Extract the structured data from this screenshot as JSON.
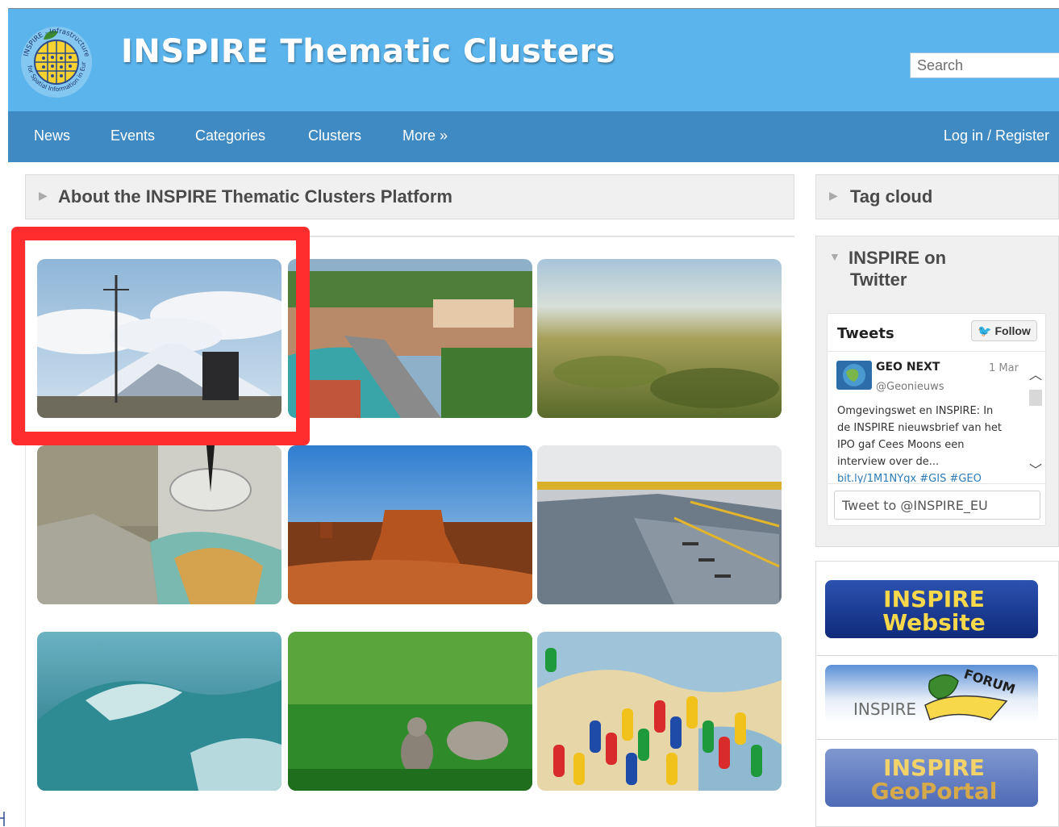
{
  "header": {
    "title": "INSPIRE Thematic Clusters",
    "logo_text_top": "INSPIRE - Infrastructure",
    "logo_text_bottom": "for Spatial Information in Europe",
    "search_placeholder": "Search"
  },
  "nav": {
    "items": [
      "News",
      "Events",
      "Categories",
      "Clusters",
      "More »"
    ],
    "login": "Log in / Register"
  },
  "main": {
    "panel_title": "About the INSPIRE Thematic Clusters Platform",
    "tiles": [
      {
        "name": "weather-station-mountain"
      },
      {
        "name": "city-bridge-lake"
      },
      {
        "name": "aerial-landscape"
      },
      {
        "name": "map-compass-relief"
      },
      {
        "name": "desert-mesa"
      },
      {
        "name": "industrial-hall"
      },
      {
        "name": "ocean-wave"
      },
      {
        "name": "squirrel-grass"
      },
      {
        "name": "map-pins"
      }
    ]
  },
  "sidebar": {
    "tag_cloud_title": "Tag cloud",
    "twitter_title_line1": "INSPIRE on",
    "twitter_title_line2": "Twitter",
    "twitter": {
      "header": "Tweets",
      "follow": "Follow",
      "tweet": {
        "author": "GEO NEXT",
        "handle": "@Geonieuws",
        "date": "1 Mar",
        "lines": [
          "Omgevingswet en INSPIRE:  In",
          "de INSPIRE nieuwsbrief van het",
          "IPO gaf Cees Moons een",
          "interview over de...",
          "bit.ly/1M1NYgx #GIS #GEO"
        ]
      },
      "compose": "Tweet to @INSPIRE_EU"
    },
    "banners": {
      "website": {
        "line1": "INSPIRE",
        "line2": "Website"
      },
      "forum": {
        "word": "INSPIRE",
        "tag": "FORUM"
      },
      "geoportal": {
        "line1": "INSPIRE",
        "line2": "GeoPortal"
      }
    }
  },
  "colors": {
    "header_bg": "#5bb4ec",
    "nav_bg": "#3f8ac3",
    "highlight": "#ff2d2d",
    "banner_yellow": "#f7d84a"
  }
}
